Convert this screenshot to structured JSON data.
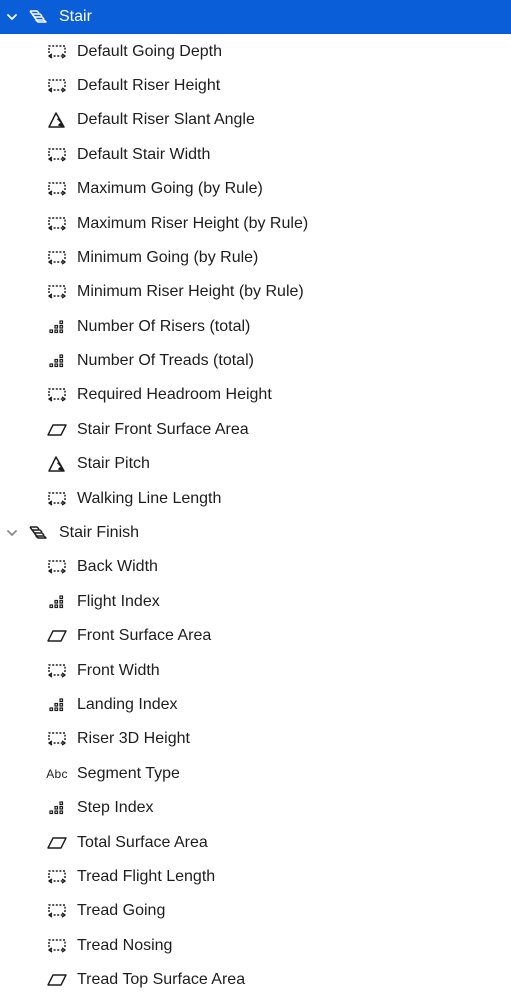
{
  "colors": {
    "selection": "#0a5ed8",
    "text": "#1d1d1f",
    "chevron_unselected": "#8a8a8e"
  },
  "groups": [
    {
      "label": "Stair",
      "icon": "stair-icon",
      "expanded": true,
      "selected": true,
      "items": [
        {
          "label": "Default Going Depth",
          "icon": "dimension-icon"
        },
        {
          "label": "Default Riser Height",
          "icon": "dimension-icon"
        },
        {
          "label": "Default Riser Slant Angle",
          "icon": "angle-icon"
        },
        {
          "label": "Default Stair Width",
          "icon": "dimension-icon"
        },
        {
          "label": "Maximum Going (by Rule)",
          "icon": "dimension-icon"
        },
        {
          "label": "Maximum Riser Height (by Rule)",
          "icon": "dimension-icon"
        },
        {
          "label": "Minimum Going (by Rule)",
          "icon": "dimension-icon"
        },
        {
          "label": "Minimum Riser Height (by Rule)",
          "icon": "dimension-icon"
        },
        {
          "label": "Number Of Risers (total)",
          "icon": "count-icon"
        },
        {
          "label": "Number Of Treads (total)",
          "icon": "count-icon"
        },
        {
          "label": "Required Headroom Height",
          "icon": "dimension-icon"
        },
        {
          "label": "Stair Front Surface Area",
          "icon": "area-icon"
        },
        {
          "label": "Stair Pitch",
          "icon": "angle-icon"
        },
        {
          "label": "Walking Line Length",
          "icon": "dimension-icon"
        }
      ]
    },
    {
      "label": "Stair Finish",
      "icon": "stair-icon",
      "expanded": true,
      "selected": false,
      "items": [
        {
          "label": "Back Width",
          "icon": "dimension-icon"
        },
        {
          "label": "Flight Index",
          "icon": "count-icon"
        },
        {
          "label": "Front Surface Area",
          "icon": "area-icon"
        },
        {
          "label": "Front Width",
          "icon": "dimension-icon"
        },
        {
          "label": "Landing Index",
          "icon": "count-icon"
        },
        {
          "label": "Riser 3D Height",
          "icon": "dimension-icon"
        },
        {
          "label": "Segment Type",
          "icon": "text-icon",
          "icon_text": "Abc"
        },
        {
          "label": "Step Index",
          "icon": "count-icon"
        },
        {
          "label": "Total Surface Area",
          "icon": "area-icon"
        },
        {
          "label": "Tread Flight Length",
          "icon": "dimension-icon"
        },
        {
          "label": "Tread Going",
          "icon": "dimension-icon"
        },
        {
          "label": "Tread Nosing",
          "icon": "dimension-icon"
        },
        {
          "label": "Tread Top Surface Area",
          "icon": "area-icon"
        }
      ]
    }
  ]
}
